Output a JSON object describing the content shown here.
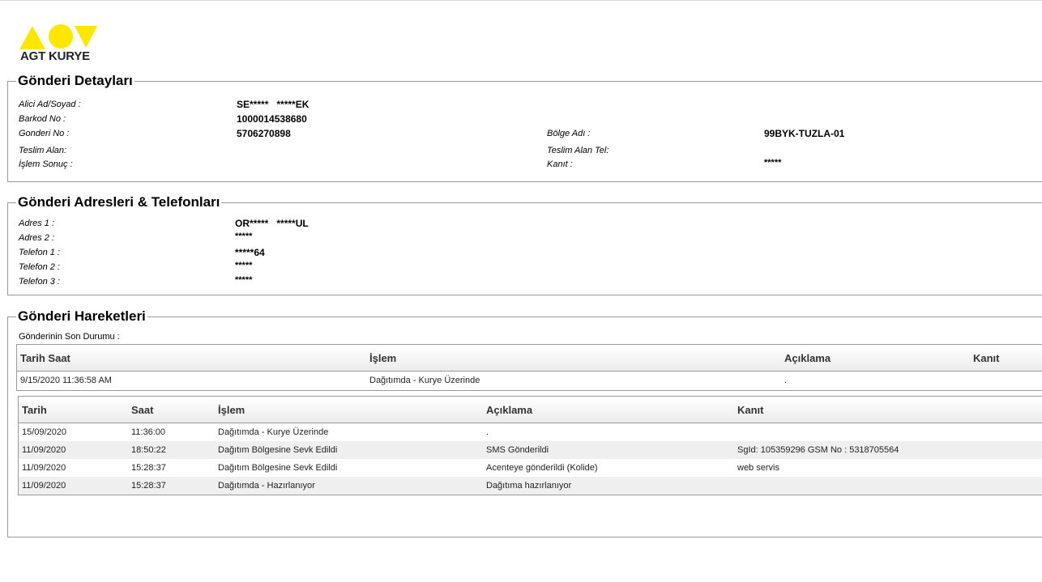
{
  "brand": {
    "name": "AGT KURYE",
    "color": "#FFE600"
  },
  "details": {
    "title": "Gönderi Detayları",
    "alici_label": "Alici Ad/Soyad :",
    "alici_value": "SE*****   *****EK",
    "barkod_label": "Barkod No :",
    "barkod_value": "1000014538680",
    "gonderi_label": "Gonderi No :",
    "gonderi_value": "5706270898",
    "bolge_label": "Bölge Adı :",
    "bolge_value": "99BYK-TUZLA-01",
    "teslim_label": "Teslim Alan:",
    "teslim_value": "",
    "teslim_tel_label": "Teslim Alan Tel:",
    "teslim_tel_value": "",
    "islem_label": "İşlem Sonuç :",
    "islem_value": "",
    "kanit_label": "Kanıt :",
    "kanit_value": "*****"
  },
  "addresses": {
    "title": "Gönderi Adresleri & Telefonları",
    "adres1_label": "Adres 1 :",
    "adres1_value": "OR*****   *****UL",
    "adres2_label": "Adres 2 :",
    "adres2_value": "*****",
    "tel1_label": "Telefon 1 :",
    "tel1_value": "*****64",
    "tel2_label": "Telefon 2 :",
    "tel2_value": "*****",
    "tel3_label": "Telefon 3 :",
    "tel3_value": "*****"
  },
  "movements": {
    "title": "Gönderi Hareketleri",
    "last_status_label": "Gönderinin Son Durumu :",
    "last_status": {
      "headers": [
        "Tarih Saat",
        "İşlem",
        "Açıklama",
        "Kanıt"
      ],
      "row": [
        "9/15/2020 11:36:58 AM",
        "Dağıtımda - Kurye Üzerinde",
        ".",
        ""
      ]
    },
    "history": {
      "headers": [
        "Tarih",
        "Saat",
        "İşlem",
        "Açıklama",
        "Kanıt"
      ],
      "rows": [
        [
          "15/09/2020",
          "11:36:00",
          "Dağıtımda - Kurye Üzerinde",
          ".",
          ""
        ],
        [
          "11/09/2020",
          "18:50:22",
          "Dağıtım Bölgesine Sevk Edildi",
          "SMS Gönderildi",
          "SgId: 105359296 GSM No : 5318705564"
        ],
        [
          "11/09/2020",
          "15:28:37",
          "Dağıtım Bölgesine Sevk Edildi",
          "Acenteye gönderildi (Kolide)",
          "web servis"
        ],
        [
          "11/09/2020",
          "15:28:37",
          "Dağıtımda - Hazırlanıyor",
          "Dağıtıma hazırlanıyor",
          ""
        ]
      ]
    }
  }
}
